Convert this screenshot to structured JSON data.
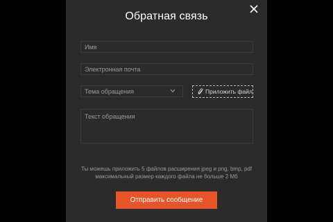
{
  "modal": {
    "title": "Обратная связь",
    "close_icon": "close-icon"
  },
  "form": {
    "name_placeholder": "Имя",
    "email_placeholder": "Электронная почта",
    "topic_placeholder": "Тема обращения",
    "attach_label": "Приложить файл",
    "attach_icon": "paperclip-icon",
    "message_placeholder": "Текст обращения",
    "hint_line1": "Ты можешь приложить 5 файлов расширения jpeg и png, bmp, pdf",
    "hint_line2": "максимальный размер каждого файла не больше 2 Мб",
    "submit_label": "Отправить сообщение"
  },
  "colors": {
    "backdrop": "#000000",
    "modal_bg": "#2b2b2b",
    "accent": "#e8542a",
    "placeholder": "#9a9a9a"
  }
}
